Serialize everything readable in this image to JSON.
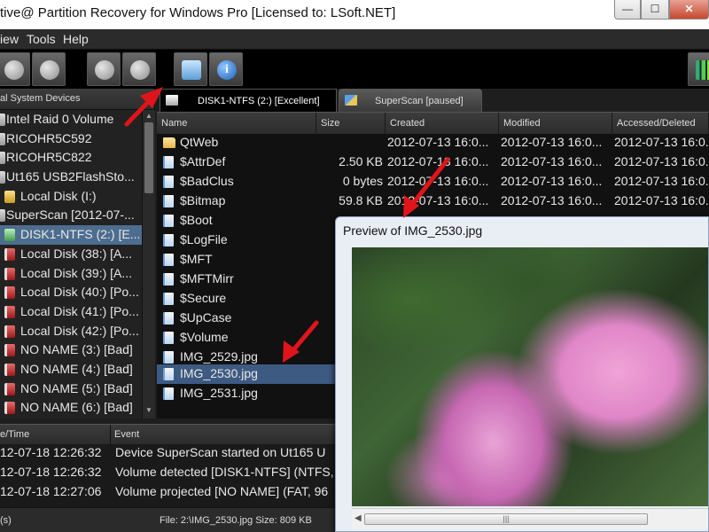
{
  "window": {
    "title": "tive@ Partition Recovery for Windows Pro [Licensed to: LSoft.NET]",
    "min_glyph": "—",
    "max_glyph": "☐",
    "close_glyph": "✕"
  },
  "menu": {
    "view": "iew",
    "tools": "Tools",
    "help": "Help"
  },
  "toolbar": {
    "info_glyph": "i"
  },
  "devices": {
    "header": "al System Devices",
    "items": [
      {
        "label": "Intel   Raid 0 Volume",
        "icon": "disk-icon"
      },
      {
        "label": "RICOHR5C592",
        "icon": "disk-icon"
      },
      {
        "label": "RICOHR5C822",
        "icon": "disk-icon"
      },
      {
        "label": "Ut165   USB2FlashSto...",
        "icon": "disk-icon"
      },
      {
        "label": "Local Disk (I:)",
        "icon": "volume-warning-icon"
      },
      {
        "label": "SuperScan [2012-07-...",
        "icon": "scan-icon"
      },
      {
        "label": "DISK1-NTFS (2:) [E...",
        "icon": "volume-good-icon"
      },
      {
        "label": "Local Disk (38:) [A...",
        "icon": "volume-bad-icon"
      },
      {
        "label": "Local Disk (39:) [A...",
        "icon": "volume-bad-icon"
      },
      {
        "label": "Local Disk (40:) [Po...",
        "icon": "volume-bad-icon"
      },
      {
        "label": "Local Disk (41:) [Po...",
        "icon": "volume-bad-icon"
      },
      {
        "label": "Local Disk (42:) [Po...",
        "icon": "volume-bad-icon"
      },
      {
        "label": "NO NAME (3:) [Bad]",
        "icon": "volume-bad-icon"
      },
      {
        "label": "NO NAME (4:) [Bad]",
        "icon": "volume-bad-icon"
      },
      {
        "label": "NO NAME (5:) [Bad]",
        "icon": "volume-bad-icon"
      },
      {
        "label": "NO NAME (6:) [Bad]",
        "icon": "volume-bad-icon"
      }
    ]
  },
  "tabs": [
    {
      "label": "DISK1-NTFS (2:) [Excellent]"
    },
    {
      "label": "SuperScan [paused]"
    }
  ],
  "files": {
    "columns": [
      "Name",
      "Size",
      "Created",
      "Modified",
      "Accessed/Deleted"
    ],
    "rows": [
      {
        "name": "QtWeb",
        "size": "",
        "created": "2012-07-13 16:0...",
        "modified": "2012-07-13 16:0...",
        "accessed": "2012-07-13 16:0..."
      },
      {
        "name": "$AttrDef",
        "size": "2.50 KB",
        "created": "2012-07-13 16:0...",
        "modified": "2012-07-13 16:0...",
        "accessed": "2012-07-13 16:0..."
      },
      {
        "name": "$BadClus",
        "size": "0 bytes",
        "created": "2012-07-13 16:0...",
        "modified": "2012-07-13 16:0...",
        "accessed": "2012-07-13 16:0..."
      },
      {
        "name": "$Bitmap",
        "size": "59.8 KB",
        "created": "2012-07-13 16:0...",
        "modified": "2012-07-13 16:0...",
        "accessed": "2012-07-13 16:0..."
      },
      {
        "name": "$Boot",
        "size": "",
        "created": "",
        "modified": "",
        "accessed": ""
      },
      {
        "name": "$LogFile",
        "size": "",
        "created": "",
        "modified": "",
        "accessed": ""
      },
      {
        "name": "$MFT",
        "size": "",
        "created": "",
        "modified": "",
        "accessed": ""
      },
      {
        "name": "$MFTMirr",
        "size": "",
        "created": "",
        "modified": "",
        "accessed": ""
      },
      {
        "name": "$Secure",
        "size": "",
        "created": "",
        "modified": "",
        "accessed": ""
      },
      {
        "name": "$UpCase",
        "size": "",
        "created": "",
        "modified": "",
        "accessed": ""
      },
      {
        "name": "$Volume",
        "size": "",
        "created": "",
        "modified": "",
        "accessed": ""
      },
      {
        "name": "IMG_2529.jpg",
        "size": "",
        "created": "",
        "modified": "",
        "accessed": ""
      },
      {
        "name": "IMG_2530.jpg",
        "size": "",
        "created": "",
        "modified": "",
        "accessed": ""
      },
      {
        "name": "IMG_2531.jpg",
        "size": "",
        "created": "",
        "modified": "",
        "accessed": ""
      }
    ]
  },
  "log": {
    "columns": [
      "e/Time",
      "Event"
    ],
    "rows": [
      {
        "time": "12-07-18 12:26:32",
        "event": "Device SuperScan started on Ut165   U"
      },
      {
        "time": "12-07-18 12:26:32",
        "event": "Volume detected [DISK1-NTFS] (NTFS, "
      },
      {
        "time": "12-07-18 12:27:06",
        "event": "Volume projected [NO NAME] (FAT, 96"
      }
    ]
  },
  "status": {
    "left": "(s)",
    "file": "File: 2:\\IMG_2530.jpg  Size: 809 KB"
  },
  "preview": {
    "title": "Preview of IMG_2530.jpg",
    "scroll_grip": "|||"
  }
}
